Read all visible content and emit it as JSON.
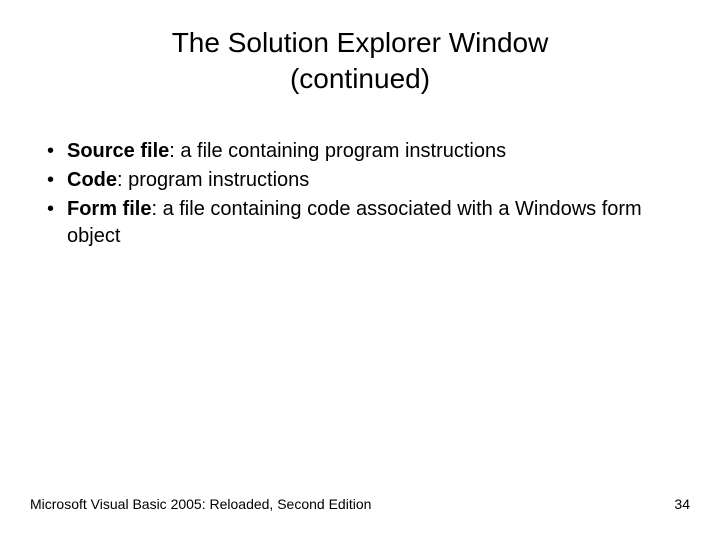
{
  "title_line1": "The Solution Explorer Window",
  "title_line2": "(continued)",
  "bullets": [
    {
      "term": "Source file",
      "definition": ": a file containing program instructions"
    },
    {
      "term": "Code",
      "definition": ": program instructions"
    },
    {
      "term": "Form file",
      "definition": ": a file containing code associated with a Windows form object"
    }
  ],
  "footer_text": "Microsoft Visual Basic 2005: Reloaded, Second Edition",
  "page_number": "34"
}
